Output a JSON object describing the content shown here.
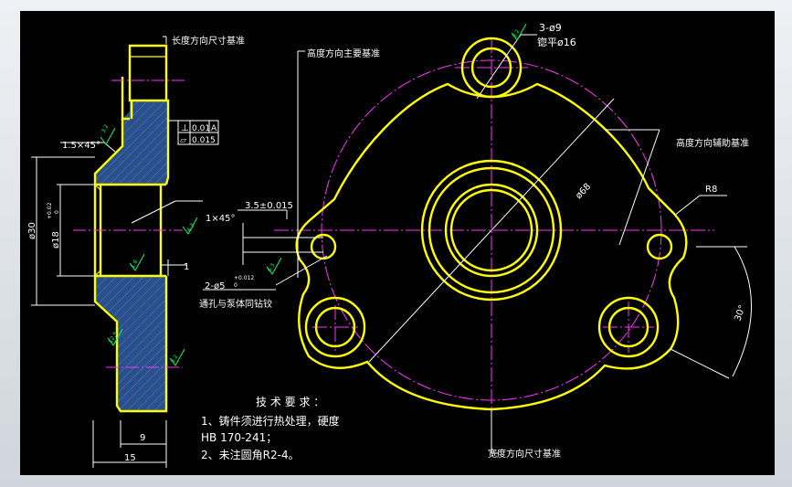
{
  "drawing": {
    "datums": {
      "length": "长度方向尺寸基准",
      "height_main": "高度方向主要基准",
      "height_aux": "高度方向辅助基准",
      "width": "宽度方向尺寸基准"
    },
    "dims": {
      "holes3": "3-ø9",
      "spotface": "锪平ø16",
      "chamfer_top": "1.5×45°",
      "chamfer_bore": "1×45°",
      "dia30": "ø30",
      "dia18": "ø18",
      "dia18_tol_up": "+0.02",
      "dia18_tol_lo": "0",
      "offset": "3.5±0.015",
      "pin_holes": "2-ø5",
      "pin_holes_tol_up": "+0.012",
      "pin_holes_tol_lo": "0",
      "pin_note": "通孔与泵体同钻铰",
      "pcd": "ø68",
      "radius": "R8",
      "angle": "30°",
      "w9": "9",
      "w15": "15",
      "w1": "1"
    },
    "fcf": {
      "row1_symbol": "⊥",
      "row1_value": "0.01",
      "row1_datum": "A",
      "row2_symbol": "▱",
      "row2_value": "0.015"
    },
    "roughness": [
      "3.2",
      "6.3",
      "1.6",
      "12.5",
      "3.2",
      "3.2",
      "6.3"
    ],
    "notes": {
      "title": "技 术 要 求 ：",
      "line1": "1、铸件须进行热处理，硬度",
      "line2": "HB 170-241；",
      "line3": "2、未注圆角R2-4。"
    },
    "colors": {
      "outline": "#ffff00",
      "center": "#ff33ff",
      "dimension": "#ffffff",
      "hatch": "#2f5fa0",
      "symbol": "#00ff66"
    }
  }
}
